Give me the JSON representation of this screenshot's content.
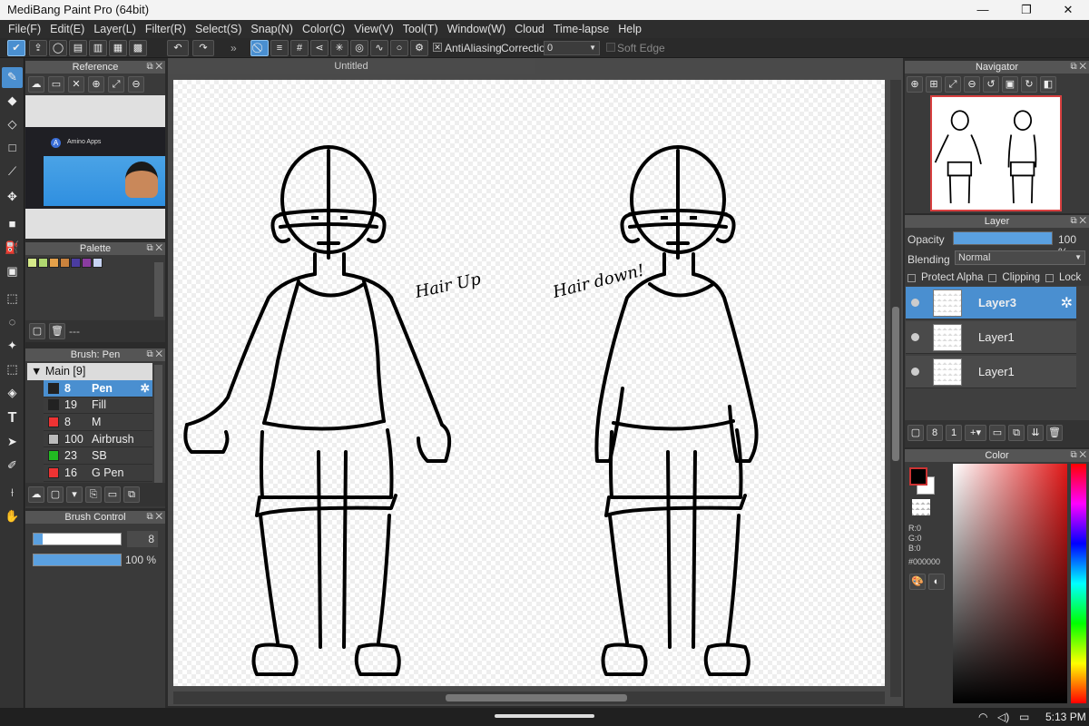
{
  "window": {
    "title": "MediBang Paint Pro (64bit)",
    "min": "—",
    "max": "❐",
    "close": "✕"
  },
  "menu": [
    "File(F)",
    "Edit(E)",
    "Layer(L)",
    "Filter(R)",
    "Select(S)",
    "Snap(N)",
    "Color(C)",
    "View(V)",
    "Tool(T)",
    "Window(W)",
    "Cloud",
    "Time-lapse",
    "Help"
  ],
  "toolbar": {
    "antialias_label": "AntiAliasing",
    "correction_label": "Correction",
    "correction_value": "0",
    "soft_edge_label": "Soft Edge"
  },
  "reference": {
    "title": "Reference",
    "thumb_title": "Amino Apps"
  },
  "palette": {
    "title": "Palette",
    "colors": [
      "#d6ea8a",
      "#b0d870",
      "#e3a04a",
      "#c9823d",
      "#4a3ca0",
      "#8a3ca0",
      "#c8d4f4"
    ],
    "footer": "---"
  },
  "brush": {
    "title": "Brush: Pen",
    "group": "Main [9]",
    "items": [
      {
        "size": "8",
        "name": "Pen",
        "color": "#222222"
      },
      {
        "size": "19",
        "name": "Fill",
        "color": "#222222"
      },
      {
        "size": "8",
        "name": "M",
        "color": "#ee3333"
      },
      {
        "size": "100",
        "name": "Airbrush",
        "color": "#bbbbbb"
      },
      {
        "size": "23",
        "name": "SB",
        "color": "#22bb22"
      },
      {
        "size": "16",
        "name": "G Pen",
        "color": "#ee3333"
      }
    ]
  },
  "brush_control": {
    "title": "Brush Control",
    "size": "8",
    "size_fraction": 0.1,
    "opacity": "100 %",
    "opacity_fraction": 1.0
  },
  "document": {
    "tab": "Untitled"
  },
  "canvas_text": {
    "left_note": "Hair Up",
    "right_note": "Hair down!"
  },
  "navigator": {
    "title": "Navigator"
  },
  "layer": {
    "title": "Layer",
    "opacity_label": "Opacity",
    "opacity_value": "100 %",
    "opacity_fraction": 1.0,
    "blending_label": "Blending",
    "blending_value": "Normal",
    "protect_alpha": "Protect Alpha",
    "clipping": "Clipping",
    "lock": "Lock",
    "layers": [
      {
        "name": "Layer3"
      },
      {
        "name": "Layer1"
      },
      {
        "name": "Layer1"
      }
    ]
  },
  "color": {
    "title": "Color",
    "r": "R:0",
    "g": "G:0",
    "b": "B:0",
    "hex": "#000000",
    "foreground": "#000000",
    "accent": "#4a8fd0"
  },
  "taskbar": {
    "time": "5:13 PM"
  }
}
